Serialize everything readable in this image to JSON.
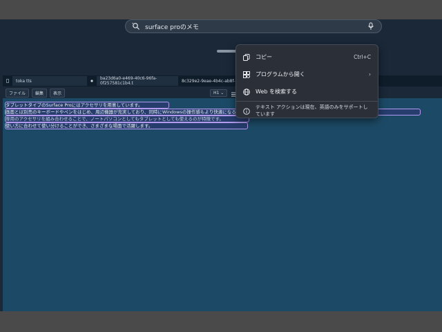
{
  "search": {
    "query": "surface proのメモ"
  },
  "tabs": [
    {
      "label": "toka tts"
    },
    {
      "label": "ba23d6a0-e469-40c6-96fa-0f257581c1b4.t"
    },
    {
      "label": "8c329e2-9eae-4b4c-ab8f-63"
    }
  ],
  "menu": {
    "file": "ファイル",
    "edit": "編集",
    "view": "表示",
    "heading": "H1"
  },
  "editor_lines": [
    "タブレットタイプのSurface Proにはアクセサリを用意しています。",
    "画面とは別売のキーボードやペンをはじめ、周辺機器が充実しており、同時にWindowsの操作感もより快適になるよう設計されています。",
    "専用のアクセサリを組み合わせることで、ノートパソコンとしてもタブレットとしても使えるのが特徴です。",
    "使い方に合わせて使い分けることができ、さまざまな場面で活躍します。"
  ],
  "context_menu": {
    "copy": {
      "label": "コピー",
      "shortcut": "Ctrl+C"
    },
    "open_with": {
      "label": "プログラムから開く"
    },
    "search_web": {
      "label": "Web を検索する"
    },
    "info": {
      "label": "テキスト アクションは現在、英語のみをサポートしています"
    }
  },
  "colors": {
    "desktop": "#1a2838",
    "editor_bg": "#1c4a66",
    "selection_outline": "#b49bf0",
    "menu_bg": "#2b2f38"
  }
}
